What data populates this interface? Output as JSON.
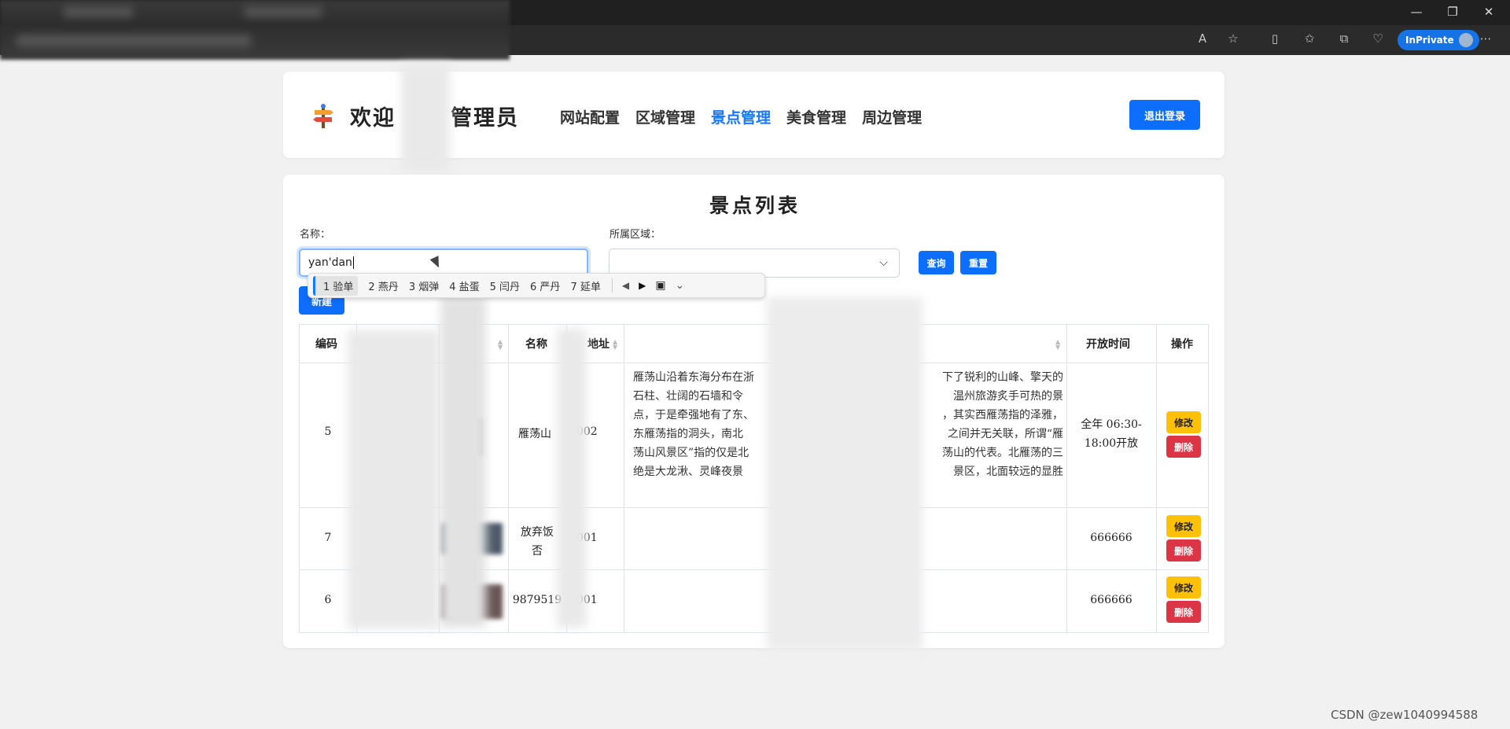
{
  "browser": {
    "inprivate_label": "InPrivate",
    "window_controls": [
      "—",
      "❐",
      "✕"
    ]
  },
  "header": {
    "welcome_text": "欢迎您，管理员",
    "welcome_left": "欢迎",
    "welcome_right": "管理员",
    "nav": [
      {
        "label": "网站配置",
        "active": false
      },
      {
        "label": "区域管理",
        "active": false
      },
      {
        "label": "景点管理",
        "active": true
      },
      {
        "label": "美食管理",
        "active": false
      },
      {
        "label": "周边管理",
        "active": false
      }
    ],
    "logout_label": "退出登录"
  },
  "list": {
    "title": "景点列表",
    "name_label": "名称：",
    "name_value": "yan'dan",
    "region_label": "所属区域：",
    "region_value": "",
    "query_label": "查询",
    "reset_label": "重置",
    "new_label": "新建"
  },
  "ime": {
    "candidates": [
      "1 验单",
      "2 燕丹",
      "3 烟弹",
      "4 盐蛋",
      "5 闫丹",
      "6 严丹",
      "7 延单"
    ]
  },
  "table": {
    "headers": {
      "code": "编码",
      "name": "名称",
      "address": "地址",
      "open_time": "开放时间",
      "actions": "操作"
    },
    "rows": [
      {
        "code": "5",
        "name": "雁荡山",
        "address": "5002",
        "desc_lines": [
          "雁荡山沿着东海分布在浙",
          "石柱、壮阔的石墙和令",
          "点，于是牵强地有了东、",
          "东雁荡指的洞头，南北",
          "荡山风景区”指的仅是北",
          "绝是大龙湫、灵峰夜景"
        ],
        "desc_right_lines": [
          "下了锐利的山峰、擎天的",
          "温州旅游炙手可热的景",
          "，其实西雁荡指的泽雅，",
          "之间并无关联，所谓“雁",
          "荡山的代表。北雁荡的三",
          "景区，北面较远的显胜"
        ],
        "open_time_lines": [
          "全年 06:30-",
          "18:00开放"
        ],
        "edit_label": "修改",
        "delete_label": "删除"
      },
      {
        "code": "7",
        "name_lines": [
          "放弃饭",
          "否"
        ],
        "address": "5001",
        "open_time_lines": [
          "666666"
        ],
        "edit_label": "修改",
        "delete_label": "删除"
      },
      {
        "code": "6",
        "name": "9879519",
        "address": "5001",
        "open_time_lines": [
          "666666"
        ],
        "edit_label": "修改",
        "delete_label": "删除"
      }
    ]
  },
  "watermark": "CSDN @zew1040994588",
  "colors": {
    "primary": "#0d6efd",
    "active_nav": "#1677ff",
    "edit": "#ffc107",
    "delete": "#dc3545"
  }
}
